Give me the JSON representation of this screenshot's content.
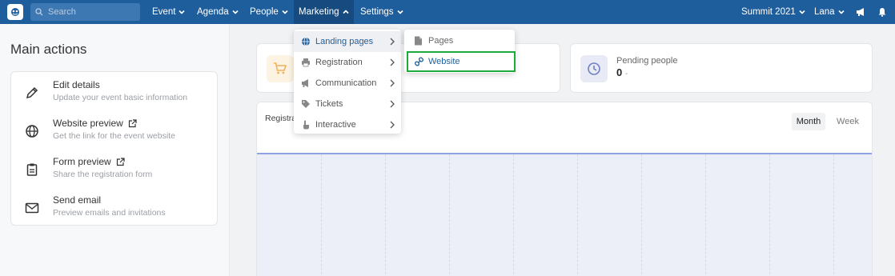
{
  "nav": {
    "search_placeholder": "Search",
    "items": [
      {
        "label": "Event"
      },
      {
        "label": "Agenda"
      },
      {
        "label": "People"
      },
      {
        "label": "Marketing"
      },
      {
        "label": "Settings"
      }
    ],
    "event_selector": "Summit 2021",
    "user": "Lana"
  },
  "left": {
    "title": "Main actions",
    "actions": [
      {
        "title": "Edit details",
        "desc": "Update your event basic information",
        "icon": "pencil-icon"
      },
      {
        "title": "Website preview",
        "desc": "Get the link for the event website",
        "icon": "globe-icon"
      },
      {
        "title": "Form preview",
        "desc": "Share the registration form",
        "icon": "clipboard-icon"
      },
      {
        "title": "Send email",
        "desc": "Preview emails and invitations",
        "icon": "envelope-icon"
      }
    ]
  },
  "stats": {
    "pending_label": "Pending people",
    "pending_value": "0",
    "pending_suffix": "-"
  },
  "chart": {
    "title": "Registra",
    "toggle_month": "Month",
    "toggle_week": "Week"
  },
  "marketing_menu": {
    "items": [
      {
        "label": "Landing pages",
        "icon": "globe-icon"
      },
      {
        "label": "Registration",
        "icon": "printer-icon"
      },
      {
        "label": "Communication",
        "icon": "megaphone-icon"
      },
      {
        "label": "Tickets",
        "icon": "tags-icon"
      },
      {
        "label": "Interactive",
        "icon": "pointer-hand-icon"
      }
    ]
  },
  "submenu": {
    "items": [
      {
        "label": "Pages",
        "icon": "file-icon"
      },
      {
        "label": "Website",
        "icon": "link-icon"
      }
    ]
  },
  "colors": {
    "topbar": "#1f5e9c",
    "highlight": "#1faa3c",
    "cart_bg": "#fdf3e3",
    "clock_bg": "#e8ebf6"
  }
}
